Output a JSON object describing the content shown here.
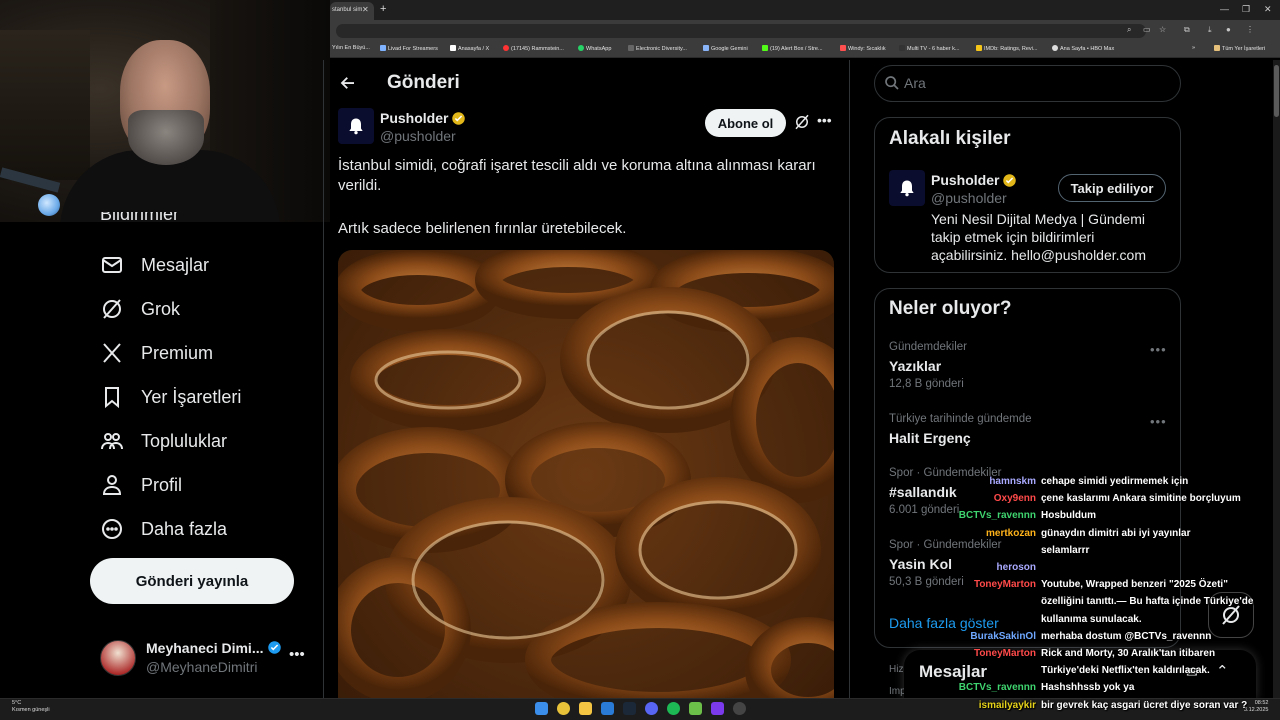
{
  "browser": {
    "tab_title": "stanbul sim",
    "bookmarks": [
      "Yılın En Büyü...",
      "Livad For Streamers",
      "Anasayfa / X",
      "(17145) Rammstein...",
      "WhatsApp",
      "Electronic Diversity...",
      "Google Gemini",
      "(19) Alert Box / Stre...",
      "Windy: Sıcaklık",
      "Multi TV - 6 haber k...",
      "IMDb: Ratings, Revi...",
      "Ana Sayfa • HBO Max",
      "Tüm Yer İşaretleri"
    ]
  },
  "nav": {
    "partial_label": "Bildirimler",
    "items": [
      {
        "label": "Mesajlar",
        "icon": "mail-icon"
      },
      {
        "label": "Grok",
        "icon": "grok-icon"
      },
      {
        "label": "Premium",
        "icon": "x-logo-icon"
      },
      {
        "label": "Yer İşaretleri",
        "icon": "bookmark-icon"
      },
      {
        "label": "Topluluklar",
        "icon": "communities-icon"
      },
      {
        "label": "Profil",
        "icon": "profile-icon"
      },
      {
        "label": "Daha fazla",
        "icon": "more-circle-icon"
      }
    ],
    "post_button": "Gönderi yayınla",
    "profile": {
      "name": "Meyhaneci Dimi...",
      "handle": "@MeyhaneDimitri"
    }
  },
  "post": {
    "page_title": "Gönderi",
    "author_name": "Pusholder",
    "author_handle": "@pusholder",
    "subscribe_label": "Abone ol",
    "text_line1": "İstanbul simidi, coğrafi işaret tescili aldı ve koruma altına alınması kararı verildi.",
    "text_line2": "Artık sadece belirlenen fırınlar üretebilecek."
  },
  "right": {
    "search_placeholder": "Ara",
    "related_title": "Alakalı kişiler",
    "related": {
      "name": "Pusholder",
      "handle": "@pusholder",
      "follow_label": "Takip ediliyor",
      "bio": "Yeni Nesil Dijital Medya | Gündemi takip etmek için bildirimleri açabilirsiniz. hello@pusholder.com"
    },
    "trends_title": "Neler oluyor?",
    "trends": [
      {
        "meta": "Gündemdekiler",
        "name": "Yazıklar",
        "count": "12,8 B gönderi"
      },
      {
        "meta": "Türkiye tarihinde gündemde",
        "name": "Halit Ergenç",
        "count": ""
      },
      {
        "meta": "Spor · Gündemdekiler",
        "name": "#sallandık",
        "count": "6.001 gönderi"
      },
      {
        "meta": "Spor · Gündemdekiler",
        "name": "Yasin Kol",
        "count": "50,3 B gönderi"
      }
    ],
    "show_more": "Daha fazla göster",
    "hidden_meta_1": "Hiz",
    "hidden_meta_2": "Imp",
    "messages_title": "Mesajlar"
  },
  "chat": [
    {
      "user": "hamnskm",
      "color": "#a9a9ff",
      "msg": "cehape simidi yedirmemek için"
    },
    {
      "user": "Oxy9enn",
      "color": "#ff4a4a",
      "msg": "çene kaslarımı Ankara simitine borçluyum"
    },
    {
      "user": "BCTVs_ravennn",
      "color": "#3fd46f",
      "msg": "Hosbuldum"
    },
    {
      "user": "mertkozan",
      "color": "#ffb31a",
      "msg": "günaydın dimitri abi iyi yayınlar"
    },
    {
      "user": "",
      "color": "#ffffff",
      "msg": "selamlarrr"
    },
    {
      "user": "heroson",
      "color": "#a9a9ff",
      "msg": ""
    },
    {
      "user": "ToneyMarton",
      "color": "#ff4a4a",
      "msg": "Youtube, Wrapped benzeri \"2025 Özeti\""
    },
    {
      "user": "",
      "color": "#ffffff",
      "msg": "özelliğini tanıttı.— Bu hafta içinde Türkiye'de"
    },
    {
      "user": "",
      "color": "#ffffff",
      "msg": "kullanıma sunulacak."
    },
    {
      "user": "BurakSakinOl",
      "color": "#6fa8ff",
      "msg": "merhaba dostum @BCTVs_ravennn"
    },
    {
      "user": "ToneyMarton",
      "color": "#ff4a4a",
      "msg": "Rick and Morty, 30 Aralık'tan itibaren"
    },
    {
      "user": "",
      "color": "#ffffff",
      "msg": "Türkiye'deki Netflix'ten kaldırılacak."
    },
    {
      "user": "BCTVs_ravennn",
      "color": "#3fd46f",
      "msg": "Hashshhssb yok ya"
    },
    {
      "user": "ismailyaykir",
      "color": "#e6d21a",
      "msg": "bir gevrek kaç asgari ücret diye soran var ?"
    }
  ],
  "taskbar": {
    "weather_temp": "5°C",
    "weather_desc": "Kısmen güneşli",
    "time": "08:52",
    "date": "3.12.2025"
  },
  "colors": {
    "verified": "#e2b719",
    "link": "#1d9bf0",
    "bg": "#000000",
    "border": "#2f3336"
  }
}
